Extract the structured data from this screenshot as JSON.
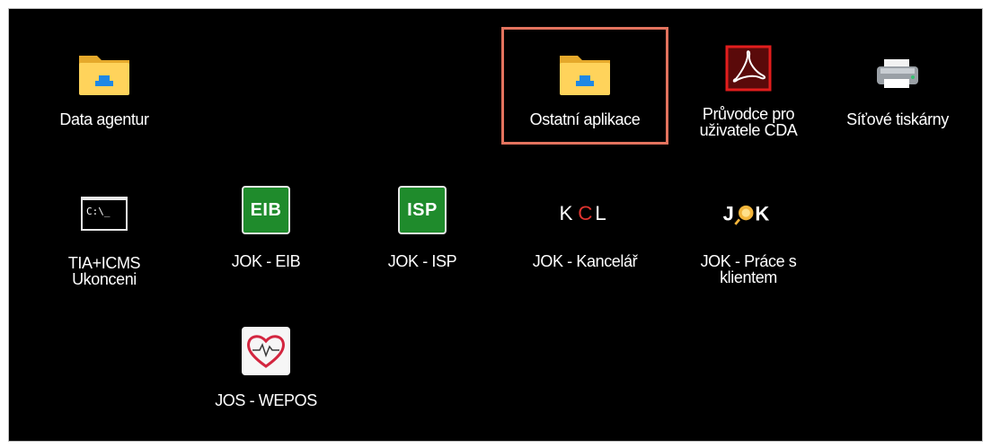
{
  "window": {
    "background": "#000000"
  },
  "highlight_color": "#e3735e",
  "icons": [
    {
      "key": "data_agentur",
      "label": "Data agentur",
      "icon": "folder-icon"
    },
    {
      "key": "ostatni_aplikace",
      "label": "Ostatní aplikace",
      "icon": "folder-icon",
      "selected": true
    },
    {
      "key": "pruvodce",
      "label_line1": "Průvodce pro",
      "label_line2": "uživatele CDA",
      "icon": "pdf-icon"
    },
    {
      "key": "sitove_tiskarny",
      "label": "Síťové tiskárny",
      "icon": "printer-icon"
    },
    {
      "key": "tia_icms",
      "label_line1": "TIA+ICMS",
      "label_line2": "Ukonceni",
      "icon": "terminal-icon",
      "icon_text": "C:\\_"
    },
    {
      "key": "jok_eib",
      "label": "JOK - EIB",
      "icon": "eib-badge-icon",
      "icon_text": "EIB"
    },
    {
      "key": "jok_isp",
      "label": "JOK - ISP",
      "icon": "isp-badge-icon",
      "icon_text": "ISP"
    },
    {
      "key": "jok_kancelar",
      "label": "JOK - Kancelář",
      "icon": "kcl-logo-icon",
      "icon_text": "KCL"
    },
    {
      "key": "jok_prace",
      "label_line1": "JOK - Práce s",
      "label_line2": "klientem",
      "icon": "jok-logo-icon",
      "icon_text": "JOK"
    },
    {
      "key": "jos_wepos",
      "label": "JOS - WEPOS",
      "icon": "heart-icon"
    }
  ]
}
